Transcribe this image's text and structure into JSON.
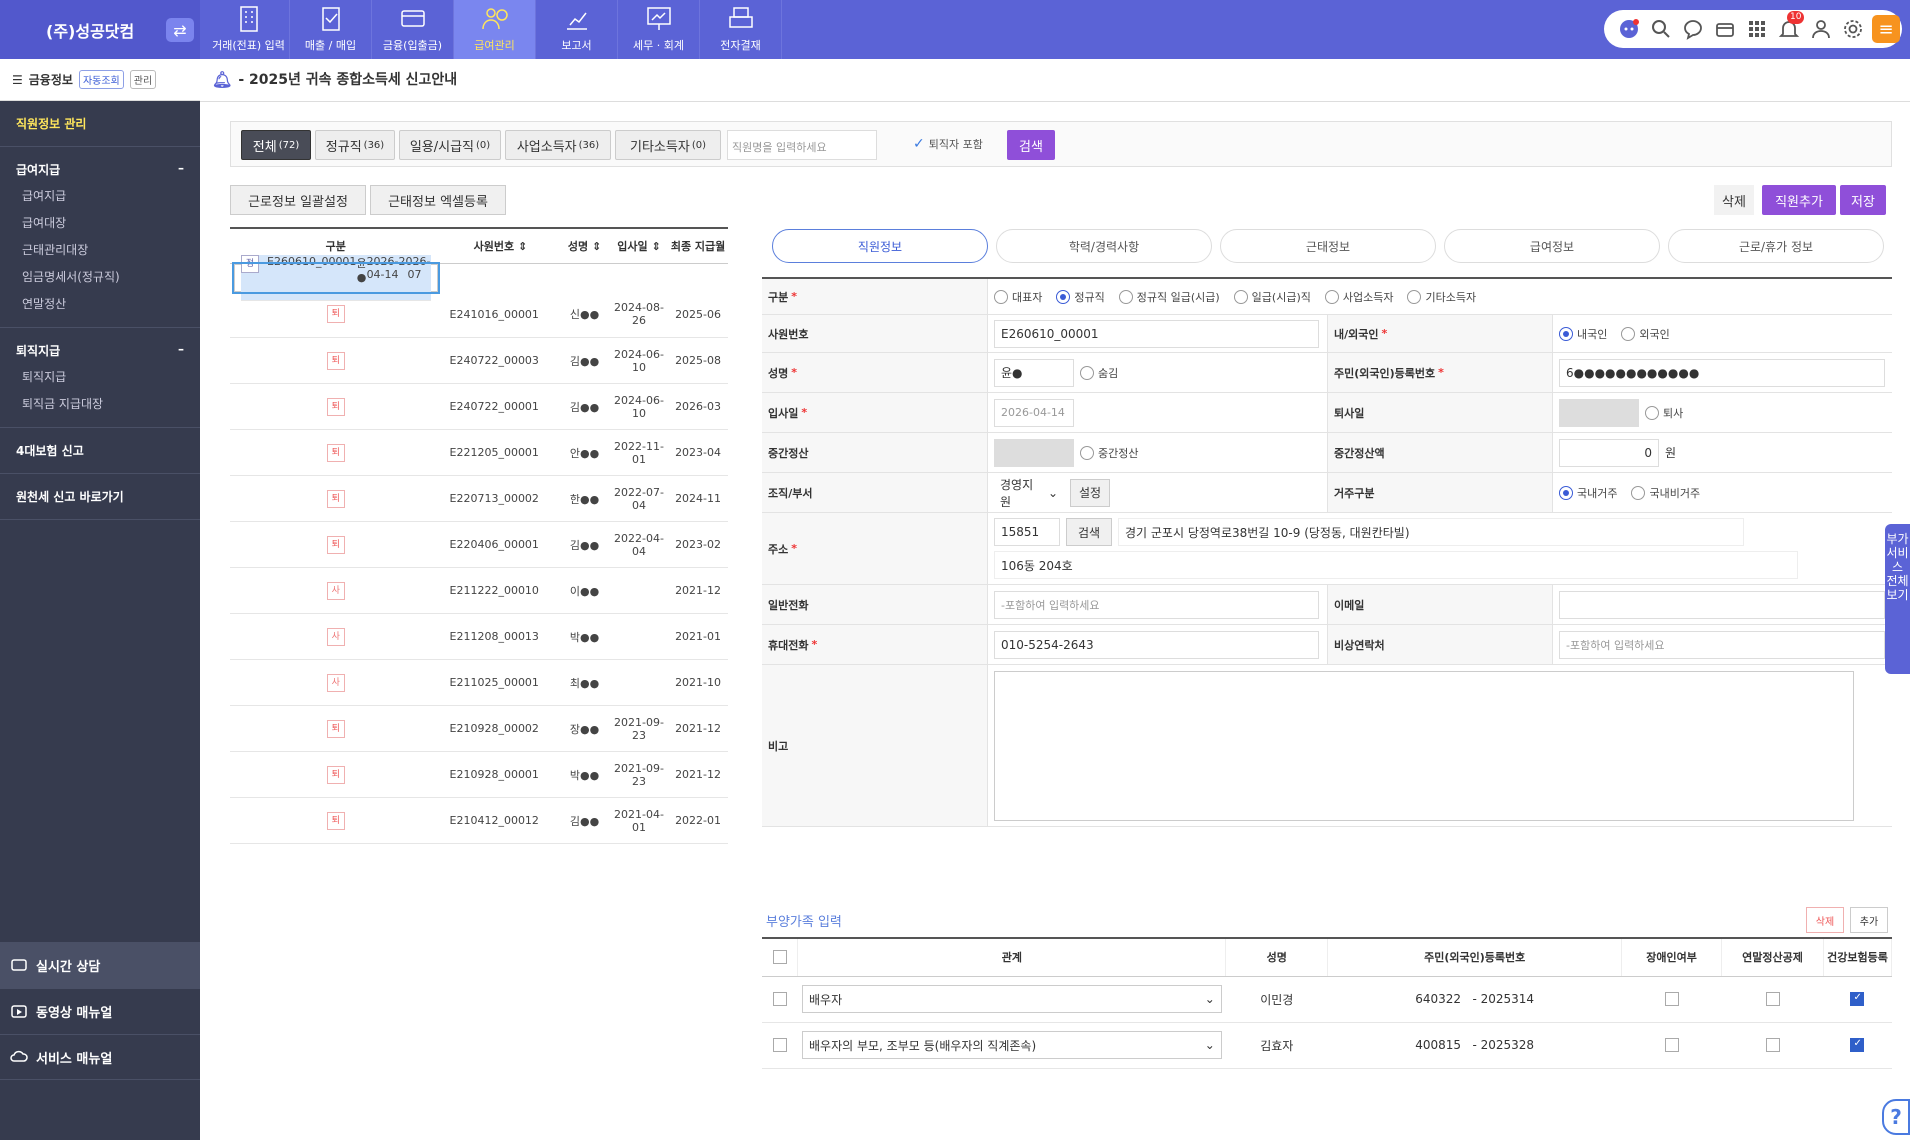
{
  "company": "(주)성공닷컴",
  "menus": [
    {
      "label": "거래(전표) 입력"
    },
    {
      "label": "매출 / 매입"
    },
    {
      "label": "금융(입출금)"
    },
    {
      "label": "급여관리",
      "active": true
    },
    {
      "label": "보고서"
    },
    {
      "label": "세무 · 회계"
    },
    {
      "label": "전자결재"
    }
  ],
  "notification_count": "10",
  "sidebar": {
    "header": "금융정보",
    "auto_btn": "자동조회",
    "manage_btn": "관리",
    "active_item": "직원정보 관리",
    "sections": [
      {
        "title": "급여지급",
        "items": [
          "급여지급",
          "급여대장",
          "근태관리대장",
          "임금명세서(정규직)",
          "연말정산"
        ]
      },
      {
        "title": "퇴직지급",
        "items": [
          "퇴직지급",
          "퇴직금 지급대장"
        ]
      }
    ],
    "link1": "4대보험 신고",
    "link2": "원천세 신고 바로가기",
    "bottom": [
      "실시간 상담",
      "동영상 매뉴얼",
      "서비스 매뉴얼"
    ]
  },
  "notice": "- 2025년 귀속 종합소득세 신고안내",
  "filters": {
    "tabs": [
      {
        "label": "전체",
        "count": "(72)"
      },
      {
        "label": "정규직",
        "count": "(36)"
      },
      {
        "label": "일용/시급직",
        "count": "(0)"
      },
      {
        "label": "사업소득자",
        "count": "(36)"
      },
      {
        "label": "기타소득자",
        "count": "(0)"
      }
    ],
    "placeholder": "직원명을 입력하세요",
    "include_retired": "퇴직자 포함",
    "search": "검색"
  },
  "buttons": {
    "bulk": "근로정보 일괄설정",
    "excel": "근태정보 엑셀등록",
    "delete": "삭제",
    "add": "직원추가",
    "save": "저장"
  },
  "list": {
    "headers": [
      "구분",
      "사원번호",
      "성명",
      "입사일",
      "최종 지급월"
    ],
    "rows": [
      {
        "type": "정",
        "id": "E260610_00001",
        "name": "윤●",
        "join": "2026-04-14",
        "last": "2026-07"
      },
      {
        "type": "퇴",
        "id": "E241016_00001",
        "name": "신●●",
        "join": "2024-08-26",
        "last": "2025-06"
      },
      {
        "type": "퇴",
        "id": "E240722_00003",
        "name": "김●●",
        "join": "2024-06-10",
        "last": "2025-08"
      },
      {
        "type": "퇴",
        "id": "E240722_00001",
        "name": "김●●",
        "join": "2024-06-10",
        "last": "2026-03"
      },
      {
        "type": "퇴",
        "id": "E221205_00001",
        "name": "안●●",
        "join": "2022-11-01",
        "last": "2023-04"
      },
      {
        "type": "퇴",
        "id": "E220713_00002",
        "name": "한●●",
        "join": "2022-07-04",
        "last": "2024-11"
      },
      {
        "type": "퇴",
        "id": "E220406_00001",
        "name": "김●●",
        "join": "2022-04-04",
        "last": "2023-02"
      },
      {
        "type": "사",
        "id": "E211222_00010",
        "name": "이●●",
        "join": "",
        "last": "2021-12"
      },
      {
        "type": "사",
        "id": "E211208_00013",
        "name": "박●●",
        "join": "",
        "last": "2021-01"
      },
      {
        "type": "사",
        "id": "E211025_00001",
        "name": "최●●",
        "join": "",
        "last": "2021-10"
      },
      {
        "type": "퇴",
        "id": "E210928_00002",
        "name": "장●●",
        "join": "2021-09-23",
        "last": "2021-12"
      },
      {
        "type": "퇴",
        "id": "E210928_00001",
        "name": "박●●",
        "join": "2021-09-23",
        "last": "2021-12"
      },
      {
        "type": "퇴",
        "id": "E210412_00012",
        "name": "김●●",
        "join": "2021-04-01",
        "last": "2022-01"
      }
    ]
  },
  "tabs": [
    "직원정보",
    "학력/경력사항",
    "근태정보",
    "급여정보",
    "근로/휴가 정보"
  ],
  "form": {
    "type_label": "구분",
    "type_opts": [
      "대표자",
      "정규직",
      "정규직 일급(시급)",
      "일급(시급)직",
      "사업소득자",
      "기타소득자"
    ],
    "empno_label": "사원번호",
    "empno": "E260610_00001",
    "nation_label": "내/외국인",
    "nation_opts": [
      "내국인",
      "외국인"
    ],
    "name_label": "성명",
    "name": "윤●",
    "hide": "숨김",
    "rrn_label": "주민(외국인)등록번호",
    "rrn": "6●●●●●●●●●●●●",
    "join_label": "입사일",
    "join": "2026-04-14",
    "leave_label": "퇴사일",
    "leave_opt": "퇴사",
    "mid_label": "중간정산",
    "mid_opt": "중간정산",
    "midamt_label": "중간정산액",
    "midamt": "0",
    "won": "원",
    "dept_label": "조직/부서",
    "dept": "경영지원",
    "dept_btn": "설정",
    "res_label": "거주구분",
    "res_opts": [
      "국내거주",
      "국내비거주"
    ],
    "addr_label": "주소",
    "zip": "15851",
    "addr_btn": "검색",
    "addr1": "경기 군포시 당정역로38번길 10-9 (당정동, 대원칸타빌)",
    "addr2": "106동 204호",
    "tel_label": "일반전화",
    "tel_ph": "-포함하여 입력하세요",
    "email_label": "이메일",
    "mobile_label": "휴대전화",
    "mobile": "010-5254-2643",
    "emerg_label": "비상연락처",
    "emerg_ph": "-포함하여 입력하세요",
    "memo_label": "비고"
  },
  "dependents": {
    "title": "부양가족 입력",
    "del": "삭제",
    "add": "추가",
    "headers": [
      "관계",
      "성명",
      "주민(외국인)등록번호",
      "장애인여부",
      "연말정산공제",
      "건강보험등록"
    ],
    "rows": [
      {
        "rel": "배우자",
        "name": "이민경",
        "rrn1": "640322",
        "rrn2": "2025314",
        "disabled": false,
        "deduct": false,
        "health": true
      },
      {
        "rel": "배우자의 부모, 조부모 등(배우자의 직계존속)",
        "name": "김효자",
        "rrn1": "400815",
        "rrn2": "2025328",
        "disabled": false,
        "deduct": false,
        "health": true
      }
    ]
  },
  "side_tab": "부가서비스 전체보기"
}
